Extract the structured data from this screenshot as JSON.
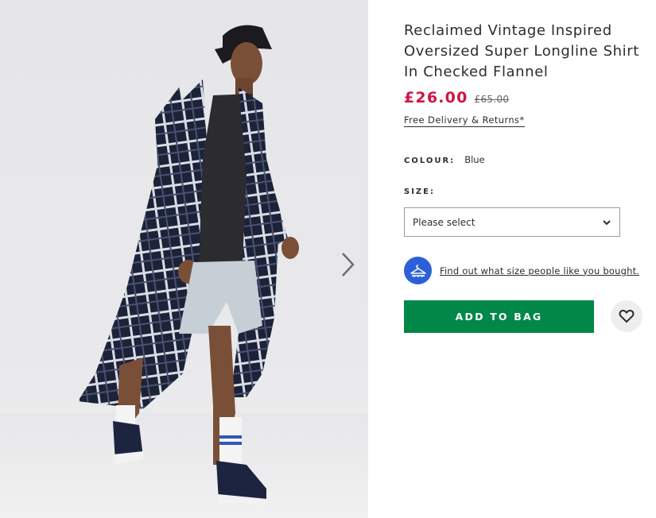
{
  "product": {
    "title": "Reclaimed Vintage Inspired Oversized Super Longline Shirt In Checked Flannel",
    "price_current": "£26.00",
    "price_previous": "£65.00",
    "delivery_link": "Free Delivery & Returns*"
  },
  "colour": {
    "label": "COLOUR:",
    "value": "Blue"
  },
  "size": {
    "label": "SIZE:",
    "selected": "Please select"
  },
  "fit_assistant": {
    "link_text": "Find out what size people like you bought."
  },
  "actions": {
    "add_to_bag": "ADD TO BAG"
  },
  "icons": {
    "next_image": "chevron-right-icon",
    "select_arrow": "chevron-down-icon",
    "fit": "hanger-icon",
    "save": "heart-icon"
  },
  "colors": {
    "price": "#d01345",
    "add_to_bag": "#018849",
    "fit_badge": "#2d60d8"
  }
}
